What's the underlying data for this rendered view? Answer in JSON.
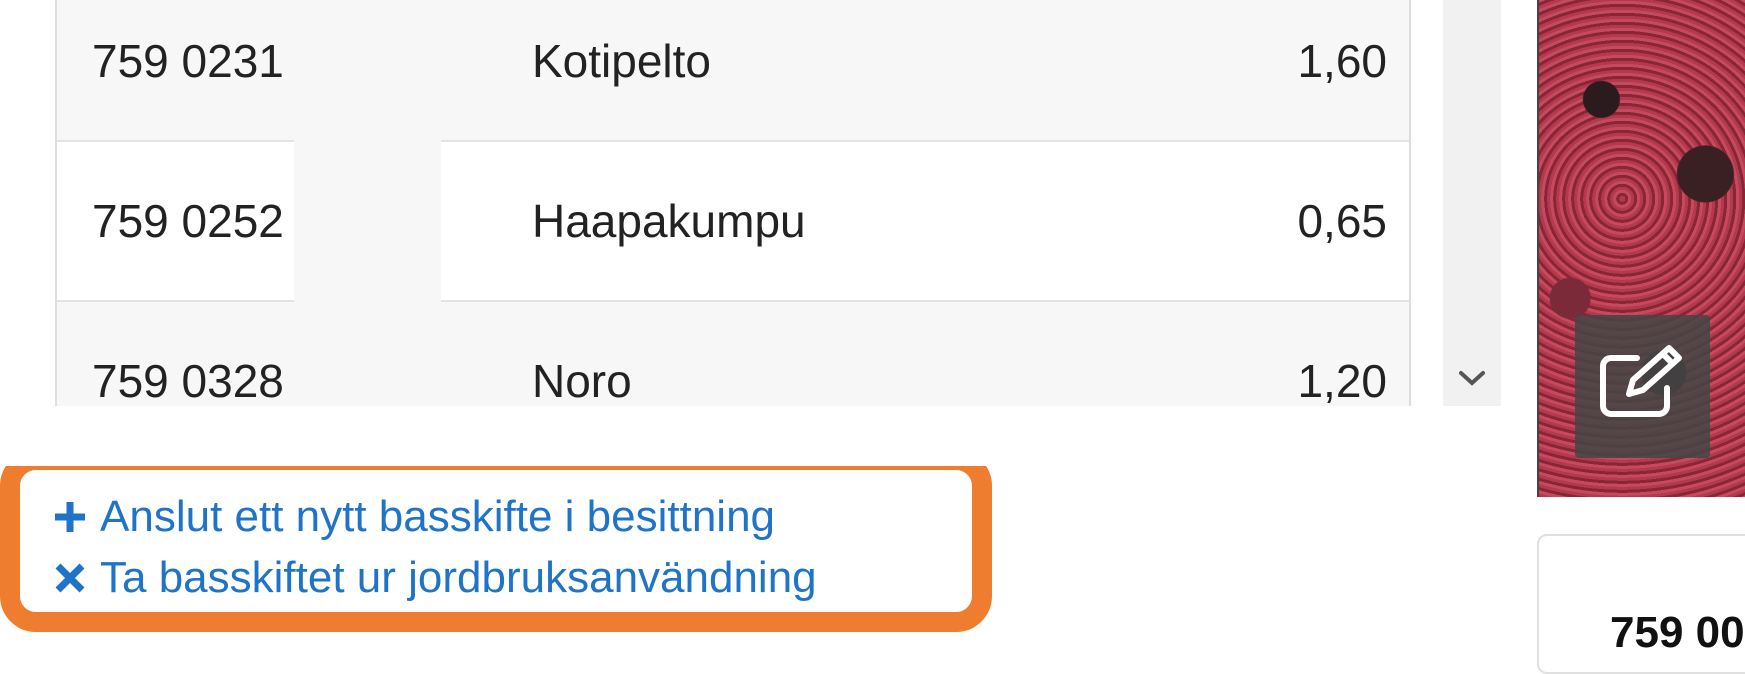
{
  "table": {
    "rows": [
      {
        "id": "759 0231",
        "name": "Kotipelto",
        "area": "1,60"
      },
      {
        "id": "759 0252",
        "name": "Haapakumpu",
        "area": "0,65"
      },
      {
        "id": "759 0328",
        "name": "Noro",
        "area": "1,20"
      }
    ]
  },
  "scrollbar": {
    "icon": "chevron-down-icon"
  },
  "map": {
    "edit_icon": "edit-icon"
  },
  "card": {
    "text": "759 00"
  },
  "actions": {
    "add_label": "Anslut ett nytt basskifte i besittning",
    "add_icon": "plus-icon",
    "remove_label": "Ta basskiftet ur jordbruksanvändning",
    "remove_icon": "close-icon"
  },
  "colors": {
    "link": "#1f74c8",
    "highlight": "#ef7d2f"
  }
}
